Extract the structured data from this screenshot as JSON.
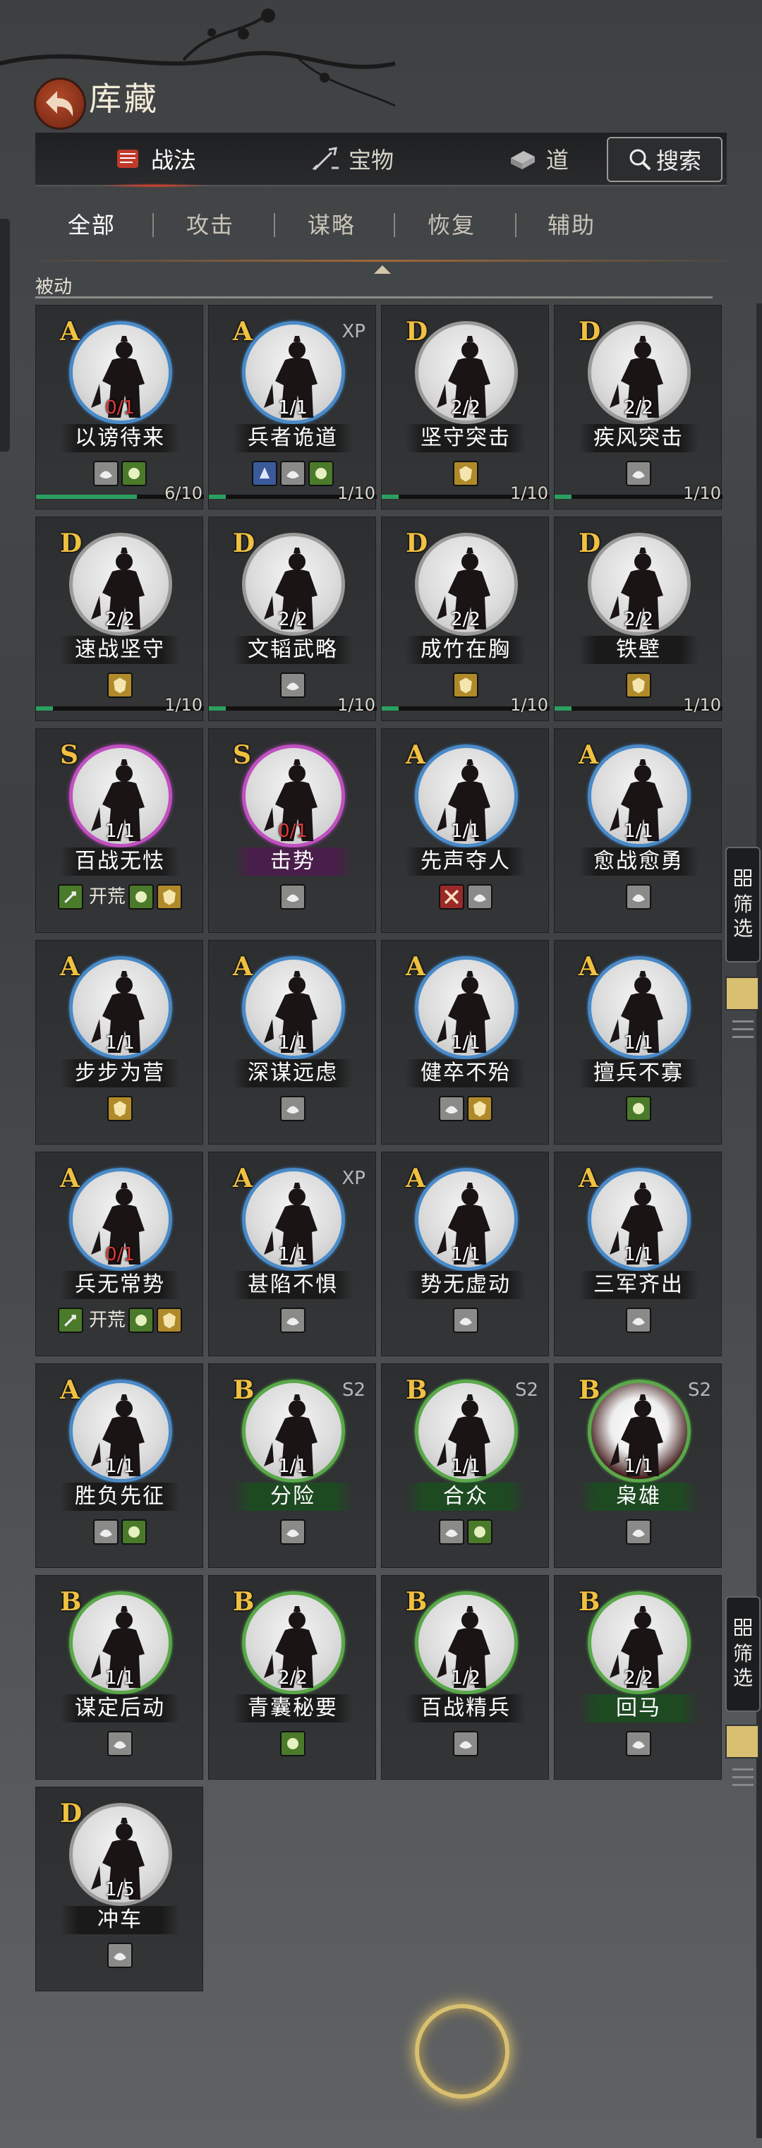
{
  "header": {
    "title": "库藏"
  },
  "main_tabs": {
    "zhanfa": "战法",
    "baowu": "宝物",
    "dao": "道",
    "search": "搜索"
  },
  "filters": {
    "all": "全部",
    "attack": "攻击",
    "strategy": "谋略",
    "recover": "恢复",
    "assist": "辅助"
  },
  "section": "被动",
  "side": {
    "filter_top": "筛",
    "filter_bottom": "选"
  },
  "cards": [
    {
      "grade": "A",
      "sup": "",
      "level": "0/1",
      "name": "以谤待来",
      "badges": [
        "gray",
        "green"
      ],
      "progress": "6/10",
      "pct": 0.6
    },
    {
      "grade": "A",
      "sup": "XP",
      "level": "1/1",
      "name": "兵者诡道",
      "badges": [
        "blue",
        "gray",
        "green"
      ],
      "progress": "1/10",
      "pct": 0.1
    },
    {
      "grade": "D",
      "sup": "",
      "level": "2/2",
      "name": "坚守突击",
      "badges": [
        "gold"
      ],
      "progress": "1/10",
      "pct": 0.1
    },
    {
      "grade": "D",
      "sup": "",
      "level": "2/2",
      "name": "疾风突击",
      "badges": [
        "gray"
      ],
      "progress": "1/10",
      "pct": 0.1
    },
    {
      "grade": "D",
      "sup": "",
      "level": "2/2",
      "name": "速战坚守",
      "badges": [
        "gold"
      ],
      "progress": "1/10",
      "pct": 0.1
    },
    {
      "grade": "D",
      "sup": "",
      "level": "2/2",
      "name": "文韬武略",
      "badges": [
        "gray"
      ],
      "progress": "1/10",
      "pct": 0.1
    },
    {
      "grade": "D",
      "sup": "",
      "level": "2/2",
      "name": "成竹在胸",
      "badges": [
        "gold"
      ],
      "progress": "1/10",
      "pct": 0.1
    },
    {
      "grade": "D",
      "sup": "",
      "level": "2/2",
      "name": "铁壁",
      "badges": [
        "gold"
      ],
      "progress": "1/10",
      "pct": 0.1
    },
    {
      "grade": "S",
      "sup": "",
      "level": "1/1",
      "name": "百战无怯",
      "badges": [
        "green-text",
        "green",
        "gold"
      ],
      "badge_text": "开荒"
    },
    {
      "grade": "S",
      "sup": "",
      "level": "0/1",
      "name": "击势",
      "badges": [
        "gray"
      ]
    },
    {
      "grade": "A",
      "sup": "",
      "level": "1/1",
      "name": "先声夺人",
      "badges": [
        "red",
        "gray"
      ]
    },
    {
      "grade": "A",
      "sup": "",
      "level": "1/1",
      "name": "愈战愈勇",
      "badges": [
        "gray"
      ]
    },
    {
      "grade": "A",
      "sup": "",
      "level": "1/1",
      "name": "步步为营",
      "badges": [
        "gold"
      ]
    },
    {
      "grade": "A",
      "sup": "",
      "level": "1/1",
      "name": "深谋远虑",
      "badges": [
        "gray"
      ]
    },
    {
      "grade": "A",
      "sup": "",
      "level": "1/1",
      "name": "健卒不殆",
      "badges": [
        "gray",
        "gold"
      ]
    },
    {
      "grade": "A",
      "sup": "",
      "level": "1/1",
      "name": "擅兵不寡",
      "badges": [
        "green"
      ]
    },
    {
      "grade": "A",
      "sup": "",
      "level": "0/1",
      "name": "兵无常势",
      "badges": [
        "green-text",
        "green",
        "gold"
      ],
      "badge_text": "开荒"
    },
    {
      "grade": "A",
      "sup": "XP",
      "level": "1/1",
      "name": "甚陷不惧",
      "badges": [
        "gray"
      ]
    },
    {
      "grade": "A",
      "sup": "",
      "level": "1/1",
      "name": "势无虚动",
      "badges": [
        "gray"
      ]
    },
    {
      "grade": "A",
      "sup": "",
      "level": "1/1",
      "name": "三军齐出",
      "badges": [
        "gray"
      ]
    },
    {
      "grade": "A",
      "sup": "",
      "level": "1/1",
      "name": "胜负先征",
      "badges": [
        "gray",
        "green"
      ]
    },
    {
      "grade": "B",
      "sup": "S2",
      "level": "1/1",
      "name": "分险",
      "badges": [
        "gray"
      ]
    },
    {
      "grade": "B",
      "sup": "S2",
      "level": "1/1",
      "name": "合众",
      "badges": [
        "gray",
        "green"
      ]
    },
    {
      "grade": "B",
      "sup": "S2",
      "level": "1/1",
      "name": "枭雄",
      "badges": [
        "gray"
      ]
    },
    {
      "grade": "B",
      "sup": "",
      "level": "1/1",
      "name": "谋定后动",
      "badges": [
        "gray"
      ]
    },
    {
      "grade": "B",
      "sup": "",
      "level": "2/2",
      "name": "青囊秘要",
      "badges": [
        "green"
      ]
    },
    {
      "grade": "B",
      "sup": "",
      "level": "1/2",
      "name": "百战精兵",
      "badges": [
        "gray"
      ]
    },
    {
      "grade": "B",
      "sup": "",
      "level": "2/2",
      "name": "回马",
      "badges": [
        "gray"
      ]
    },
    {
      "grade": "D",
      "sup": "",
      "level": "1/5",
      "name": "冲车",
      "badges": [
        "gray"
      ]
    }
  ]
}
